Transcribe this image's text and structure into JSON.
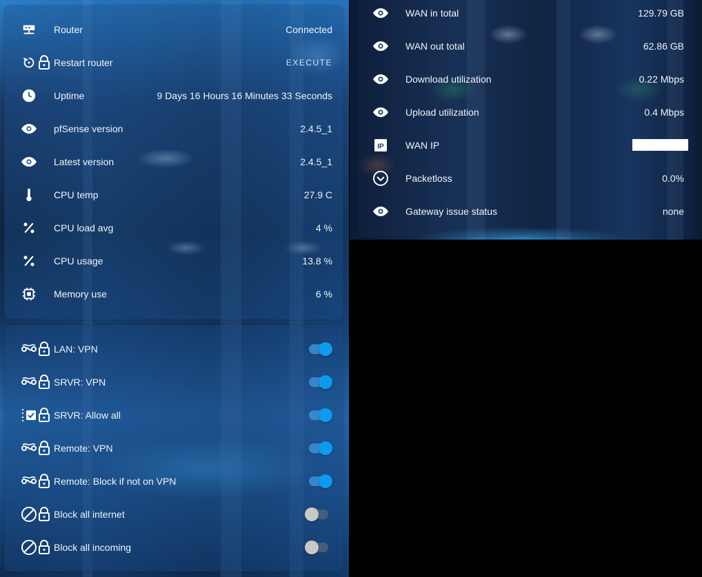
{
  "system_card": {
    "rows": [
      {
        "label": "Router",
        "value": "Connected",
        "icon": "router-network-icon"
      },
      {
        "label": "Restart router",
        "action": "EXECUTE",
        "icon": "restart-icon"
      },
      {
        "label": "Uptime",
        "value": "9 Days 16 Hours 16 Minutes 33 Seconds",
        "icon": "clock-icon"
      },
      {
        "label": "pfSense version",
        "value": "2.4.5_1",
        "icon": "eye-icon"
      },
      {
        "label": "Latest version",
        "value": "2.4.5_1",
        "icon": "eye-icon"
      },
      {
        "label": "CPU temp",
        "value": "27.9 C",
        "icon": "thermometer-icon"
      },
      {
        "label": "CPU load avg",
        "value": "4 %",
        "icon": "percent-icon"
      },
      {
        "label": "CPU usage",
        "value": "13.8 %",
        "icon": "percent-icon"
      },
      {
        "label": "Memory use",
        "value": "6 %",
        "icon": "memory-chip-icon"
      }
    ]
  },
  "rules_card": {
    "rows": [
      {
        "label": "LAN: VPN",
        "state": "on",
        "icon": "vpn-link-icon"
      },
      {
        "label": "SRVR: VPN",
        "state": "on",
        "icon": "vpn-link-icon"
      },
      {
        "label": "SRVR: Allow all",
        "state": "on",
        "icon": "checklist-icon"
      },
      {
        "label": "Remote: VPN",
        "state": "on",
        "icon": "vpn-link-icon"
      },
      {
        "label": "Remote: Block if not on VPN",
        "state": "on",
        "icon": "vpn-link-icon"
      },
      {
        "label": "Block all internet",
        "state": "off",
        "icon": "block-icon"
      },
      {
        "label": "Block all incoming",
        "state": "off",
        "icon": "block-icon"
      }
    ]
  },
  "wan_card": {
    "rows": [
      {
        "label": "WAN in total",
        "value": "129.79 GB",
        "icon": "eye-icon"
      },
      {
        "label": "WAN out total",
        "value": "62.86 GB",
        "icon": "eye-icon"
      },
      {
        "label": "Download utilization",
        "value": "0.22 Mbps",
        "icon": "eye-icon"
      },
      {
        "label": "Upload utilization",
        "value": "0.4 Mbps",
        "icon": "eye-icon"
      },
      {
        "label": "WAN IP",
        "value": "",
        "icon": "ip-icon"
      },
      {
        "label": "Packetloss",
        "value": "0.0%",
        "icon": "chevron-circle-icon"
      },
      {
        "label": "Gateway issue status",
        "value": "none",
        "icon": "eye-icon"
      }
    ]
  },
  "colors": {
    "toggle_on": "#0d9bf0",
    "toggle_off": "#c9c9c9",
    "text": "#f0f5fa"
  }
}
